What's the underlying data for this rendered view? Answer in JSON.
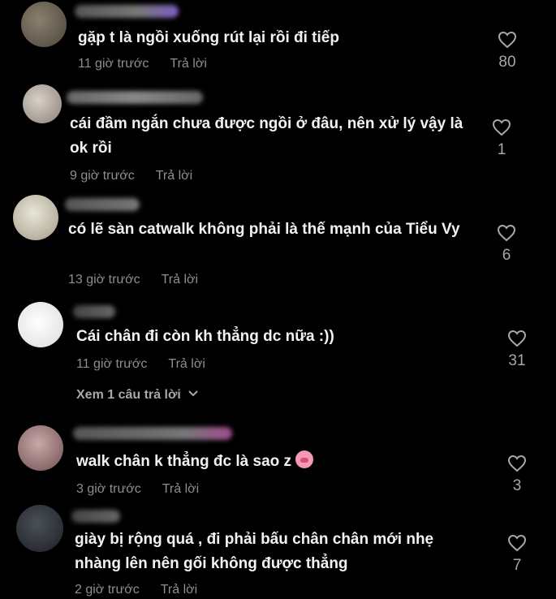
{
  "reply_label": "Trả lời",
  "comments": [
    {
      "text": "gặp t là ngồi xuống rút lại rồi đi tiếp",
      "time": "11 giờ trước",
      "likes": "80"
    },
    {
      "text": "cái đầm ngắn chưa được ngồi ở đâu, nên xử lý vậy là ok rồi",
      "time": "9 giờ trước",
      "likes": "1"
    },
    {
      "text": "có lẽ sàn catwalk không phải là thế mạnh của Tiểu Vy",
      "time": "13 giờ trước",
      "likes": "6"
    },
    {
      "text": "Cái chân đi còn kh thẳng dc nữa :))",
      "time": "11 giờ trước",
      "likes": "31",
      "view_replies": "Xem 1 câu trả lời"
    },
    {
      "text": "walk chân k thẳng đc là sao z",
      "time": "3 giờ trước",
      "likes": "3",
      "emoji": "pig-face-emoji"
    },
    {
      "text": "giày bị rộng quá , đi phải bấu chân chân mới nhẹ nhàng lên nên gối không được thẳng",
      "time": "2 giờ trước",
      "likes": "7"
    }
  ],
  "icons": {
    "like": "heart-outline-icon",
    "expand": "chevron-down-icon"
  }
}
